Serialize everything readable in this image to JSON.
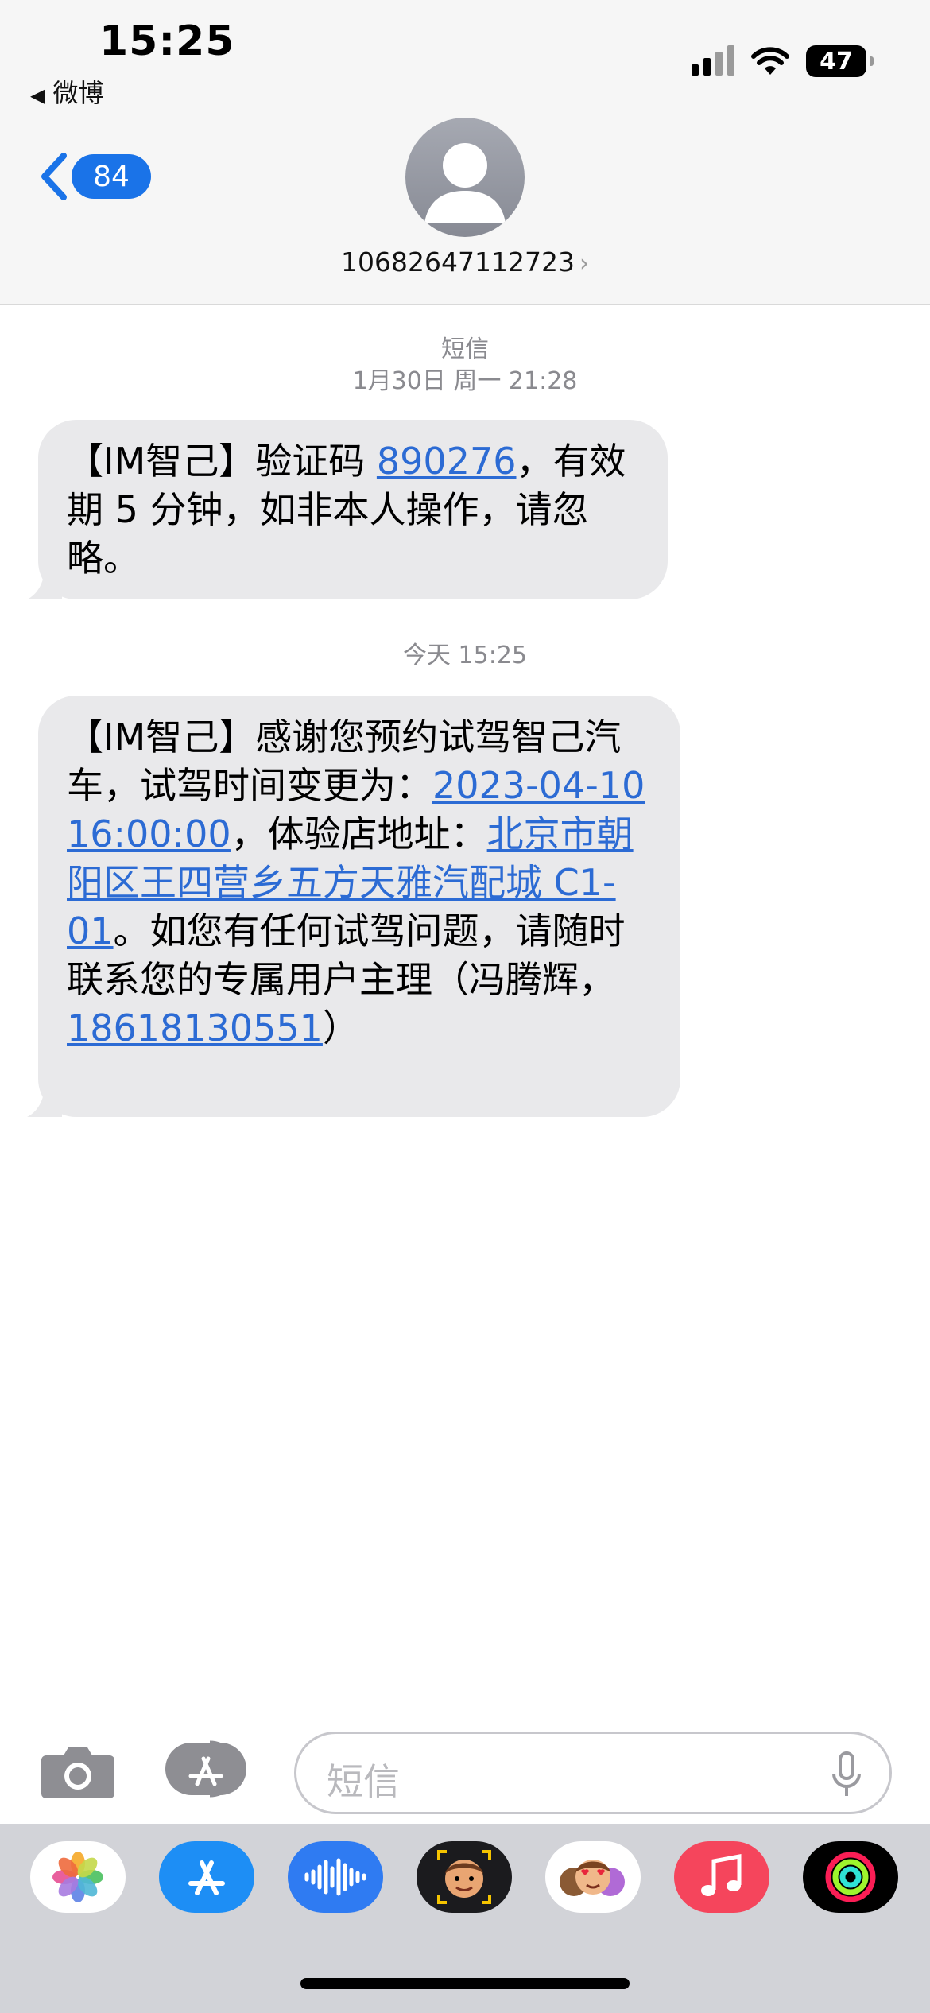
{
  "status_bar": {
    "time": "15:25",
    "back_app": "微博",
    "battery": "47"
  },
  "conversation_header": {
    "unread_count": "84",
    "contact": "10682647112723"
  },
  "messages": [
    {
      "service": "短信",
      "timestamp": "1月30日 周一 21:28",
      "parts": [
        "【IM智己】验证码 ",
        "890276",
        "，有效期 5 分钟，如非本人操作，请忽略。"
      ]
    },
    {
      "timestamp": "今天 15:25",
      "parts": [
        "【IM智己】感谢您预约试驾智己汽车，试驾时间变更为：",
        "2023-04-10 16:00:00",
        "，体验店地址：",
        "北京市朝阳区王四营乡五方天雅汽配城 C1-01",
        "。如您有任何试驾问题，请随时联系您的专属用户主理（冯腾辉，",
        "18618130551",
        "）"
      ]
    }
  ],
  "composer": {
    "placeholder": "短信"
  },
  "app_tray": [
    "photos-icon",
    "app-store-icon",
    "audio-message-icon",
    "memoji-camera-icon",
    "memoji-stickers-icon",
    "music-icon",
    "activity-icon"
  ],
  "colors": {
    "accent_blue": "#1a73e8",
    "link_blue": "#2c6bd4",
    "bubble_gray": "#e9e9eb",
    "music_red": "#f5455c"
  }
}
